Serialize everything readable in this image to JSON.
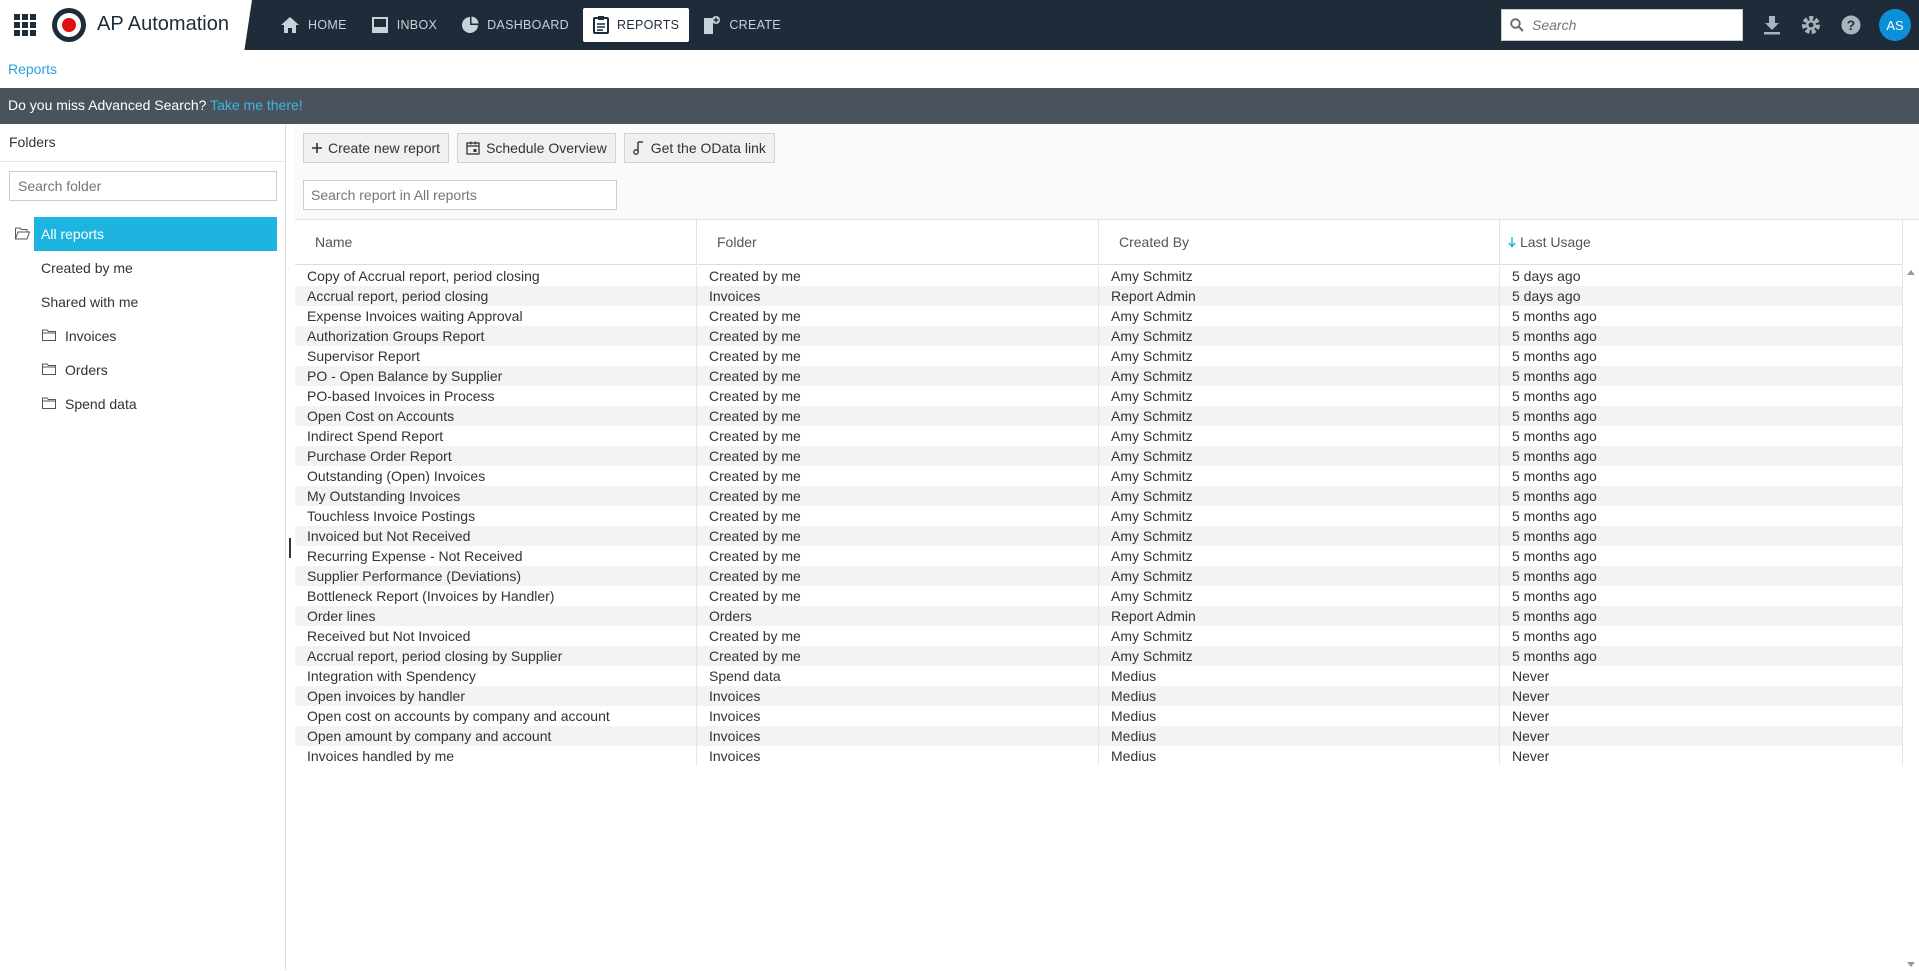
{
  "app": {
    "title": "AP Automation"
  },
  "nav": [
    {
      "label": "HOME",
      "icon": "home-icon",
      "active": false
    },
    {
      "label": "INBOX",
      "icon": "inbox-icon",
      "active": false
    },
    {
      "label": "DASHBOARD",
      "icon": "dashboard-icon",
      "active": false
    },
    {
      "label": "REPORTS",
      "icon": "reports-icon",
      "active": true
    },
    {
      "label": "CREATE",
      "icon": "create-icon",
      "active": false
    }
  ],
  "search": {
    "placeholder": "Search"
  },
  "user": {
    "initials": "AS"
  },
  "breadcrumb": "Reports",
  "banner": {
    "text": "Do you miss Advanced Search? ",
    "link": "Take me there!"
  },
  "folders": {
    "title": "Folders",
    "search_placeholder": "Search folder",
    "items": [
      {
        "label": "All reports",
        "selected": true
      },
      {
        "label": "Created by me"
      },
      {
        "label": "Shared with me"
      },
      {
        "label": "Invoices"
      },
      {
        "label": "Orders"
      },
      {
        "label": "Spend data"
      }
    ]
  },
  "toolbar": {
    "create": "Create new report",
    "schedule": "Schedule Overview",
    "odata": "Get the OData link"
  },
  "report_search": {
    "placeholder": "Search report in All reports"
  },
  "table": {
    "columns": [
      "Name",
      "Folder",
      "Created By",
      "Last Usage"
    ],
    "sort_column": "Last Usage",
    "rows": [
      [
        "Copy of Accrual report, period closing",
        "Created by me",
        "Amy Schmitz",
        "5 days ago"
      ],
      [
        "Accrual report, period closing",
        "Invoices",
        "Report Admin",
        "5 days ago"
      ],
      [
        "Expense Invoices waiting Approval",
        "Created by me",
        "Amy Schmitz",
        "5 months ago"
      ],
      [
        "Authorization Groups Report",
        "Created by me",
        "Amy Schmitz",
        "5 months ago"
      ],
      [
        "Supervisor Report",
        "Created by me",
        "Amy Schmitz",
        "5 months ago"
      ],
      [
        "PO - Open Balance by Supplier",
        "Created by me",
        "Amy Schmitz",
        "5 months ago"
      ],
      [
        "PO-based Invoices in Process",
        "Created by me",
        "Amy Schmitz",
        "5 months ago"
      ],
      [
        "Open Cost on Accounts",
        "Created by me",
        "Amy Schmitz",
        "5 months ago"
      ],
      [
        "Indirect Spend Report",
        "Created by me",
        "Amy Schmitz",
        "5 months ago"
      ],
      [
        "Purchase Order Report",
        "Created by me",
        "Amy Schmitz",
        "5 months ago"
      ],
      [
        "Outstanding (Open) Invoices",
        "Created by me",
        "Amy Schmitz",
        "5 months ago"
      ],
      [
        "My Outstanding Invoices",
        "Created by me",
        "Amy Schmitz",
        "5 months ago"
      ],
      [
        "Touchless Invoice Postings",
        "Created by me",
        "Amy Schmitz",
        "5 months ago"
      ],
      [
        "Invoiced but Not Received",
        "Created by me",
        "Amy Schmitz",
        "5 months ago"
      ],
      [
        "Recurring Expense - Not Received",
        "Created by me",
        "Amy Schmitz",
        "5 months ago"
      ],
      [
        "Supplier Performance (Deviations)",
        "Created by me",
        "Amy Schmitz",
        "5 months ago"
      ],
      [
        "Bottleneck Report (Invoices by Handler)",
        "Created by me",
        "Amy Schmitz",
        "5 months ago"
      ],
      [
        "Order lines",
        "Orders",
        "Report Admin",
        "5 months ago"
      ],
      [
        "Received but Not Invoiced",
        "Created by me",
        "Amy Schmitz",
        "5 months ago"
      ],
      [
        "Accrual report, period closing by Supplier",
        "Created by me",
        "Amy Schmitz",
        "5 months ago"
      ],
      [
        "Integration with Spendency",
        "Spend data",
        "Medius",
        "Never"
      ],
      [
        "Open invoices by handler",
        "Invoices",
        "Medius",
        "Never"
      ],
      [
        "Open cost on accounts by company and account",
        "Invoices",
        "Medius",
        "Never"
      ],
      [
        "Open amount by company and account",
        "Invoices",
        "Medius",
        "Never"
      ],
      [
        "Invoices handled by me",
        "Invoices",
        "Medius",
        "Never"
      ]
    ]
  },
  "colors": {
    "topbar": "#1e2b38",
    "accent": "#1db5e0",
    "link": "#28a3d6",
    "banner": "#4a535c"
  }
}
